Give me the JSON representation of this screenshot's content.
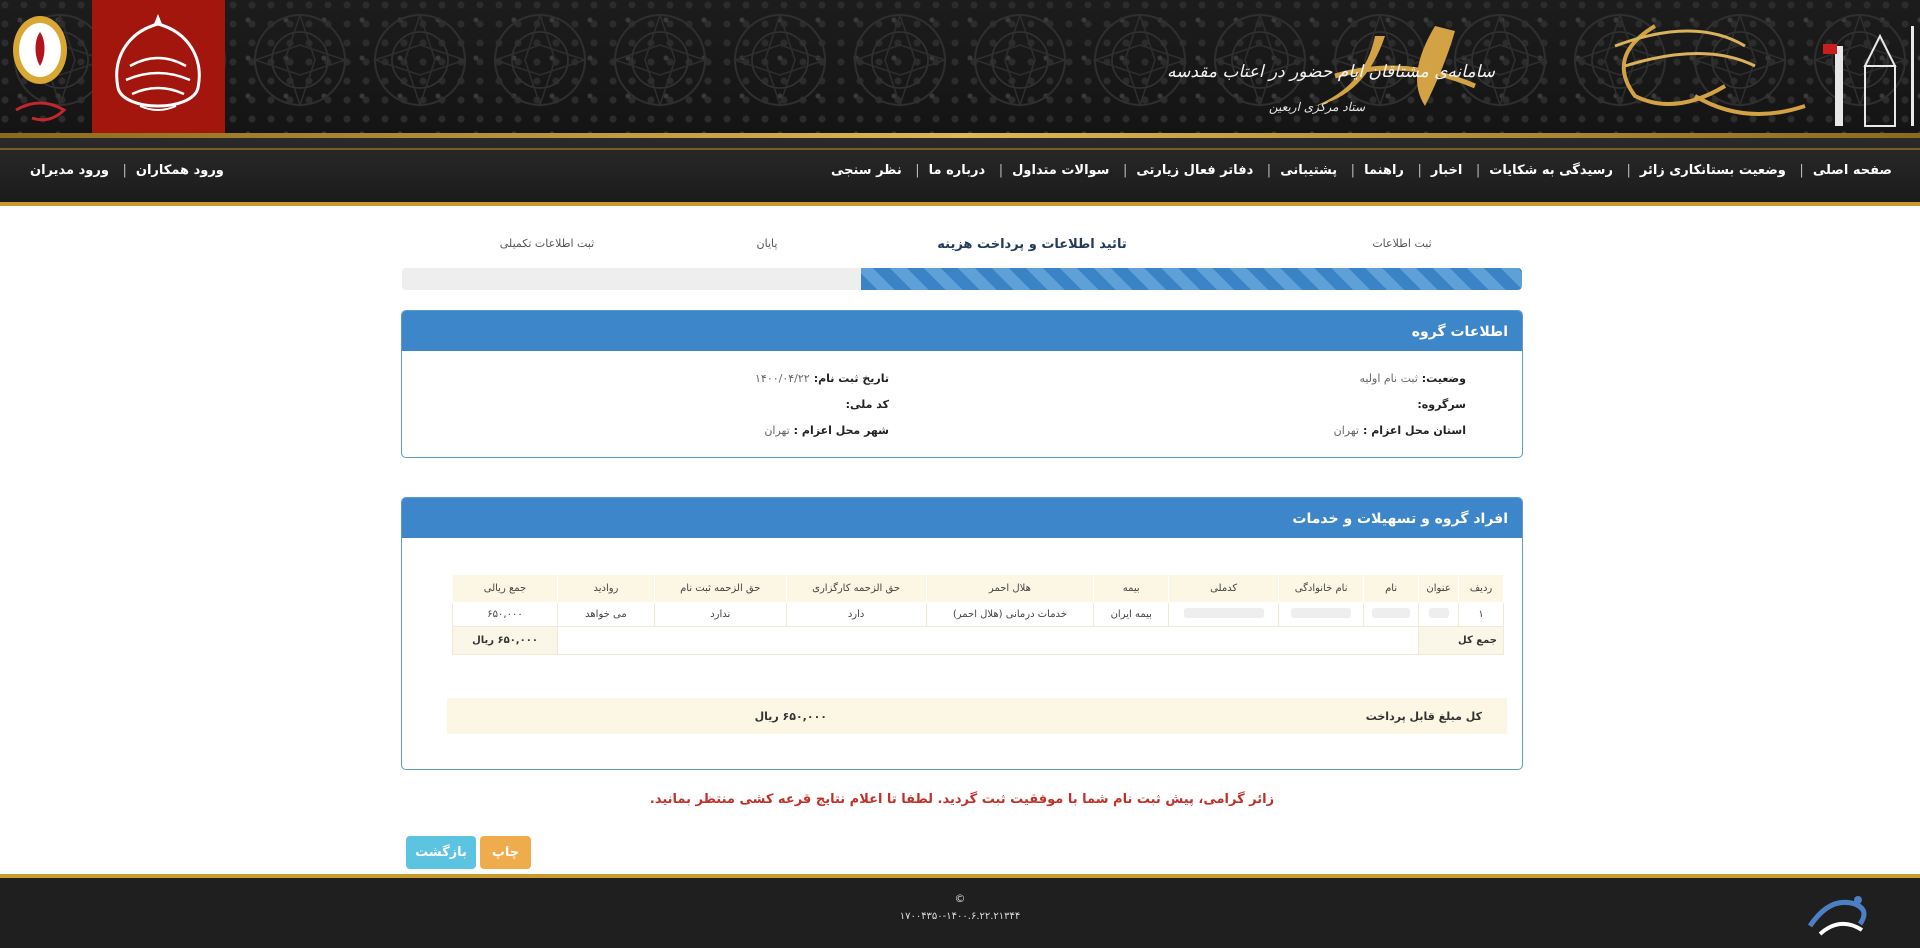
{
  "header": {
    "samah_subtitle": "سامانه‌ی مشتاقان ایام حضور در اعتاب مقدسه",
    "samah_subtitle2": "ستاد مرکزی اربعین"
  },
  "nav": {
    "right_items": [
      "صفحه اصلی",
      "وضعیت بستانکاری زائر",
      "رسیدگی به شکایات",
      "اخبار",
      "راهنما",
      "پشتیبانی",
      "دفاتر فعال زیارتی",
      "سوالات متداول",
      "درباره ما",
      "نظر سنجی"
    ],
    "left_items": [
      "ورود همکاران",
      "ورود مدیران"
    ]
  },
  "wizard": {
    "step1": "ثبت اطلاعات",
    "step2": "تائید اطلاعات و پرداخت هزینه",
    "step3": "پایان",
    "step4": "ثبت اطلاعات تکمیلی",
    "progress_percent": 59
  },
  "group_info": {
    "title": "اطلاعات گروه",
    "status_label": "وضعیت:",
    "status_value": "ثبت نام اولیه",
    "reg_date_label": "تاریخ ثبت نام:",
    "reg_date_value": "۱۴۰۰/۰۴/۲۲",
    "leader_label": "سرگروه:",
    "national_code_label": "کد ملی:",
    "province_label": "استان محل اعزام :",
    "province_value": "تهران",
    "city_label": "شهر محل اعزام :",
    "city_value": "تهران"
  },
  "members": {
    "title": "افراد گروه و تسهیلات و خدمات",
    "columns": [
      "ردیف",
      "عنوان",
      "نام",
      "نام خانوادگی",
      "کدملی",
      "بیمه",
      "هلال احمر",
      "حق الزحمه کارگزاری",
      "حق الزحمه ثبت نام",
      "روادید",
      "جمع ریالی"
    ],
    "rows": [
      {
        "row": "۱",
        "insurance": "بیمه ایران",
        "red_crescent": "خدمات درمانی (هلال احمر)",
        "agency_fee": "دارد",
        "registration_fee": "ندارد",
        "visa": "می خواهد",
        "total": "۶۵۰,۰۰۰"
      }
    ],
    "total_label": "جمع کل",
    "total_value": "۶۵۰,۰۰۰ ریال",
    "payable_label": "کل مبلغ قابل پرداخت",
    "payable_value": "۶۵۰,۰۰۰ ریال"
  },
  "message": "زائر گرامی، پیش ثبت نام شما با موفقیت ثبت گردید. لطفا تا اعلام نتایج قرعه کشی منتظر بمانید.",
  "buttons": {
    "print": "چاپ",
    "back": "بازگشت"
  },
  "footer": {
    "copyright": "©",
    "version": "۱۷۰۰۴۳۵۰-۱۴۰۰.۶.۲۲.۲۱۳۴۴"
  },
  "colors": {
    "primary": "#3c86c9",
    "accent_gold": "#c99a2e",
    "message_red": "#c0312a",
    "print_button": "#efac4d",
    "back_button": "#5cc3e0"
  }
}
